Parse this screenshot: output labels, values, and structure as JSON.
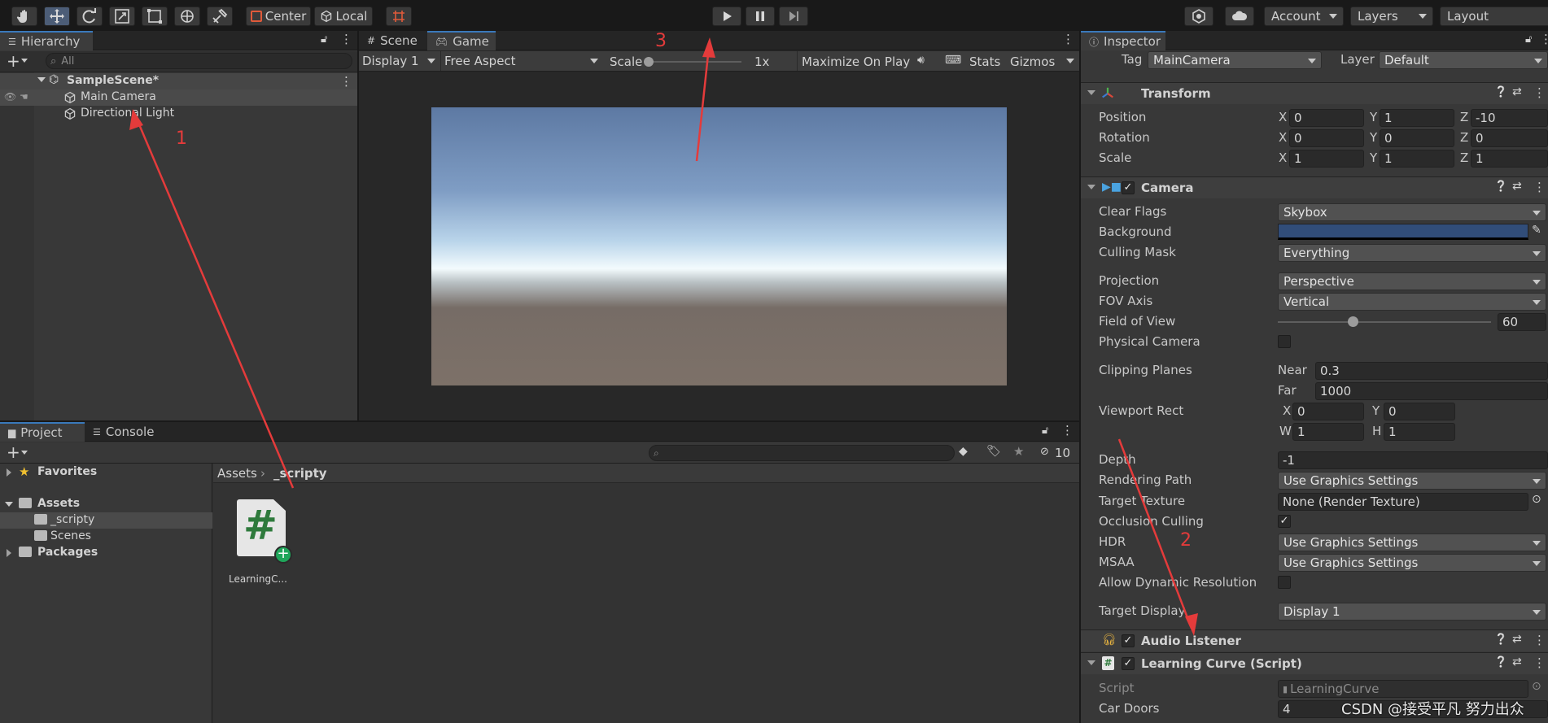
{
  "toolbar": {
    "tools": [
      "hand-tool",
      "move-tool",
      "rotate-tool",
      "scale-tool",
      "rect-tool",
      "transform-tool",
      "custom-tool"
    ],
    "pivot": "Center",
    "space": "Local",
    "account": "Account",
    "layers": "Layers",
    "layout": "Layout"
  },
  "hierarchy": {
    "tab": "Hierarchy",
    "search_placeholder": "All",
    "scene": "SampleScene*",
    "items": [
      "Main Camera",
      "Directional Light"
    ]
  },
  "game": {
    "tabs": [
      "Scene",
      "Game"
    ],
    "display": "Display 1",
    "aspect": "Free Aspect",
    "scale_label": "Scale",
    "scale_value": "1x",
    "scale_level": 0,
    "maximize": "Maximize On Play",
    "stats": "Stats",
    "gizmos": "Gizmos"
  },
  "project": {
    "tabs": [
      "Project",
      "Console"
    ],
    "hidden_count": "10",
    "tree": {
      "favorites": "Favorites",
      "assets": "Assets",
      "assets_children": [
        "_scripty",
        "Scenes"
      ],
      "packages": "Packages"
    },
    "breadcrumb": [
      "Assets",
      "_scripty"
    ],
    "file_label": "LearningC..."
  },
  "inspector": {
    "tab": "Inspector",
    "tag_label": "Tag",
    "tag": "MainCamera",
    "layer_label": "Layer",
    "layer": "Default",
    "transform": {
      "title": "Transform",
      "rows": [
        {
          "label": "Position",
          "x": "0",
          "y": "1",
          "z": "-10"
        },
        {
          "label": "Rotation",
          "x": "0",
          "y": "0",
          "z": "0"
        },
        {
          "label": "Scale",
          "x": "1",
          "y": "1",
          "z": "1"
        }
      ]
    },
    "camera": {
      "title": "Camera",
      "clear_flags_label": "Clear Flags",
      "clear_flags": "Skybox",
      "background_label": "Background",
      "background_color": "#314d79",
      "culling_mask_label": "Culling Mask",
      "culling_mask": "Everything",
      "projection_label": "Projection",
      "projection": "Perspective",
      "fov_axis_label": "FOV Axis",
      "fov_axis": "Vertical",
      "fov_label": "Field of View",
      "fov": "60",
      "fov_level": 0.35,
      "physical_label": "Physical Camera",
      "clipping_label": "Clipping Planes",
      "near_label": "Near",
      "near": "0.3",
      "far_label": "Far",
      "far": "1000",
      "viewport_label": "Viewport Rect",
      "vp_x": "0",
      "vp_y": "0",
      "vp_w": "1",
      "vp_h": "1",
      "depth_label": "Depth",
      "depth": "-1",
      "rendering_path_label": "Rendering Path",
      "rendering_path": "Use Graphics Settings",
      "target_texture_label": "Target Texture",
      "target_texture": "None (Render Texture)",
      "occlusion_label": "Occlusion Culling",
      "hdr_label": "HDR",
      "hdr": "Use Graphics Settings",
      "msaa_label": "MSAA",
      "msaa": "Use Graphics Settings",
      "dynamic_res_label": "Allow Dynamic Resolution",
      "target_display_label": "Target Display",
      "target_display": "Display 1"
    },
    "audio_listener": "Audio Listener",
    "script_component": {
      "title": "Learning Curve (Script)",
      "script_label": "Script",
      "script": "LearningCurve",
      "car_doors_label": "Car Doors",
      "car_doors": "4"
    }
  },
  "annotations": [
    "1",
    "2",
    "3"
  ],
  "watermark": "CSDN @接受平凡 努力出众"
}
